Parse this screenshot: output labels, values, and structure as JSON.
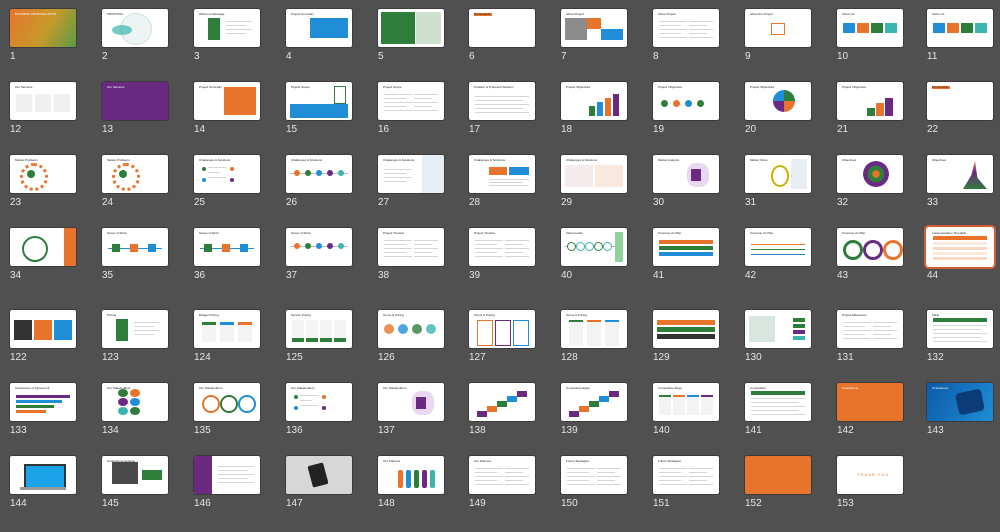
{
  "colors": {
    "background": "#505050",
    "orange": "#e8742c",
    "green": "#2e7d3a",
    "blue": "#1f8ed6",
    "purple": "#6b2a82",
    "teal": "#3bb5b0",
    "selected_border": "#d25a35"
  },
  "selected_slide": "44",
  "slides": [
    {
      "number": "1",
      "style": "cover",
      "bg": "orange",
      "title": "BUSINESS PROPOSAL PPTX"
    },
    {
      "number": "2",
      "style": "circle",
      "title": "PROPOSAL"
    },
    {
      "number": "3",
      "style": "green-left",
      "title": "Welcome Message"
    },
    {
      "number": "4",
      "style": "blue-box",
      "title": "Project Summary"
    },
    {
      "number": "5",
      "style": "green-box",
      "title": ""
    },
    {
      "number": "6",
      "style": "text-right",
      "title": "Pro Projects"
    },
    {
      "number": "7",
      "style": "photo-orange",
      "title": "About Project"
    },
    {
      "number": "8",
      "style": "text",
      "title": "About Project"
    },
    {
      "number": "9",
      "style": "text-orange",
      "title": "About the Project"
    },
    {
      "number": "10",
      "style": "blocks",
      "title": "About Us"
    },
    {
      "number": "11",
      "style": "blocks",
      "title": "About Us"
    },
    {
      "number": "12",
      "style": "grid",
      "title": "Our Services"
    },
    {
      "number": "13",
      "style": "purple",
      "title": "Our Services"
    },
    {
      "number": "14",
      "style": "orange-box",
      "title": "Project Summary"
    },
    {
      "number": "15",
      "style": "blue-bottom",
      "title": "Project Scope"
    },
    {
      "number": "16",
      "style": "text",
      "title": "Project Scope"
    },
    {
      "number": "17",
      "style": "table",
      "title": "Problem & Proposed Solution"
    },
    {
      "number": "18",
      "style": "arrows",
      "title": "Project Objectives"
    },
    {
      "number": "19",
      "style": "dots",
      "title": "Project Objectives"
    },
    {
      "number": "20",
      "style": "pie",
      "title": "Project Objectives"
    },
    {
      "number": "21",
      "style": "bars3d",
      "title": "Project Objectives"
    },
    {
      "number": "22",
      "style": "text-right",
      "title": "Pro Projects"
    },
    {
      "number": "23",
      "style": "gear",
      "title": "Market Problems"
    },
    {
      "number": "24",
      "style": "gear",
      "title": "Market Problems"
    },
    {
      "number": "25",
      "style": "list",
      "title": "Challenges & Solutions"
    },
    {
      "number": "26",
      "style": "timeline",
      "title": "Challenges & Solutions"
    },
    {
      "number": "27",
      "style": "panel",
      "title": "Challenges & Solutions"
    },
    {
      "number": "28",
      "style": "tags",
      "title": "Challenges & Solutions"
    },
    {
      "number": "29",
      "style": "two-col",
      "title": "Challenges & Solutions"
    },
    {
      "number": "30",
      "style": "illus",
      "title": "Market Analysis"
    },
    {
      "number": "31",
      "style": "bulb",
      "title": "Market Sizes"
    },
    {
      "number": "32",
      "style": "rings",
      "title": "Objectives"
    },
    {
      "number": "33",
      "style": "area",
      "title": "Objectives"
    },
    {
      "number": "34",
      "style": "circle-orange",
      "title": ""
    },
    {
      "number": "35",
      "style": "steps",
      "title": "Scope of Work"
    },
    {
      "number": "36",
      "style": "steps",
      "title": "Scope of Work"
    },
    {
      "number": "37",
      "style": "timeline",
      "title": "Scope of Work"
    },
    {
      "number": "38",
      "style": "text",
      "title": "Project Timeline"
    },
    {
      "number": "39",
      "style": "text",
      "title": "Project Timeline"
    },
    {
      "number": "40",
      "style": "nodes",
      "title": "Client Goals"
    },
    {
      "number": "41",
      "style": "table-color",
      "title": "Outcome Vs Plan"
    },
    {
      "number": "42",
      "style": "lines",
      "title": "Outcome Vs Plan"
    },
    {
      "number": "43",
      "style": "donuts",
      "title": "Outcome Vs Plan"
    },
    {
      "number": "44",
      "style": "table-orange",
      "title": "Implementation Timetable"
    },
    {
      "number": "122",
      "style": "cards-dark",
      "title": ""
    },
    {
      "number": "123",
      "style": "green-left",
      "title": "Pricing"
    },
    {
      "number": "124",
      "style": "pricing",
      "title": "Budget Pricing"
    },
    {
      "number": "125",
      "style": "pricing-green",
      "title": "Service Pricing"
    },
    {
      "number": "126",
      "style": "circles",
      "title": "Terms & Pricing"
    },
    {
      "number": "127",
      "style": "cols-pink",
      "title": "Terms & Pricing"
    },
    {
      "number": "128",
      "style": "cols",
      "title": "Terms & Pricing"
    },
    {
      "number": "129",
      "style": "bands",
      "title": ""
    },
    {
      "number": "130",
      "style": "photo-tags",
      "title": ""
    },
    {
      "number": "131",
      "style": "text",
      "title": "Project Milestones"
    },
    {
      "number": "132",
      "style": "table-green",
      "title": "Table"
    },
    {
      "number": "133",
      "style": "bars",
      "title": "Acceptance of Agreement"
    },
    {
      "number": "134",
      "style": "petals",
      "title": "Our Stakeholders"
    },
    {
      "number": "135",
      "style": "circles-row",
      "title": "Our Stakeholders"
    },
    {
      "number": "136",
      "style": "list",
      "title": "Our Stakeholders"
    },
    {
      "number": "137",
      "style": "illus",
      "title": "Our Stakeholders"
    },
    {
      "number": "138",
      "style": "stairs",
      "title": ""
    },
    {
      "number": "139",
      "style": "stairs",
      "title": "Competitive Edge"
    },
    {
      "number": "140",
      "style": "kanban",
      "title": "Competitive Edge"
    },
    {
      "number": "141",
      "style": "table-green",
      "title": "Competition"
    },
    {
      "number": "142",
      "style": "orange-full",
      "title": "Smartphone"
    },
    {
      "number": "143",
      "style": "blue-phone",
      "title": "Smartphone"
    },
    {
      "number": "144",
      "style": "laptop",
      "title": ""
    },
    {
      "number": "145",
      "style": "desktop",
      "title": "Smartphone Desktop"
    },
    {
      "number": "146",
      "style": "purple-left",
      "title": ""
    },
    {
      "number": "147",
      "style": "tablet",
      "title": ""
    },
    {
      "number": "148",
      "style": "people",
      "title": "Our Partners"
    },
    {
      "number": "149",
      "style": "text",
      "title": "Our Partners"
    },
    {
      "number": "150",
      "style": "text",
      "title": "Future Strategies"
    },
    {
      "number": "151",
      "style": "text",
      "title": "Future Strategies"
    },
    {
      "number": "152",
      "style": "orange-full",
      "title": ""
    },
    {
      "number": "153",
      "style": "thankyou",
      "title": "THANK YOU"
    }
  ]
}
